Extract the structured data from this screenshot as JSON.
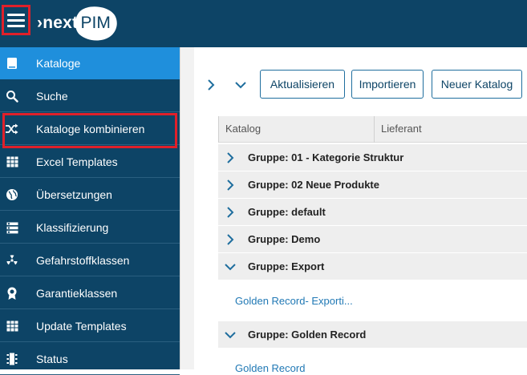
{
  "header": {
    "logo_next": "›next",
    "logo_pim": "PIM"
  },
  "sidebar": {
    "items": [
      {
        "label": "Kataloge",
        "icon": "book-icon",
        "active": true
      },
      {
        "label": "Suche",
        "icon": "search-icon",
        "active": false
      },
      {
        "label": "Kataloge kombinieren",
        "icon": "shuffle-icon",
        "active": false
      },
      {
        "label": "Excel Templates",
        "icon": "table-grid-icon",
        "active": false
      },
      {
        "label": "Übersetzungen",
        "icon": "globe-icon",
        "active": false
      },
      {
        "label": "Klassifizierung",
        "icon": "list-tree-icon",
        "active": false
      },
      {
        "label": "Gefahrstoffklassen",
        "icon": "radiation-icon",
        "active": false
      },
      {
        "label": "Garantieklassen",
        "icon": "award-badge-icon",
        "active": false
      },
      {
        "label": "Update Templates",
        "icon": "table-grid-icon",
        "active": false
      },
      {
        "label": "Status",
        "icon": "status-list-icon",
        "active": false
      }
    ]
  },
  "toolbar": {
    "expand_icon": "chevron-right-icon",
    "collapse_icon": "chevron-down-icon",
    "refresh_label": "Aktualisieren",
    "import_label": "Importieren",
    "new_catalog_label": "Neuer Katalog"
  },
  "table": {
    "columns": [
      "Katalog",
      "Lieferant"
    ],
    "groups": [
      {
        "label": "Gruppe: 01 - Kategorie Struktur",
        "expanded": false
      },
      {
        "label": "Gruppe: 02 Neue Produkte",
        "expanded": false
      },
      {
        "label": "Gruppe: default",
        "expanded": false
      },
      {
        "label": "Gruppe: Demo",
        "expanded": false
      },
      {
        "label": "Gruppe: Export",
        "expanded": true
      },
      {
        "label": "Gruppe: Golden Record",
        "expanded": true
      }
    ],
    "export_items": [
      "Golden Record- Exporti..."
    ],
    "golden_record_items": [
      "Golden Record"
    ]
  },
  "colors": {
    "navy": "#0d4466",
    "active_blue": "#1f8fdc",
    "highlight_red": "#e0202a",
    "link_blue": "#2179b5"
  }
}
